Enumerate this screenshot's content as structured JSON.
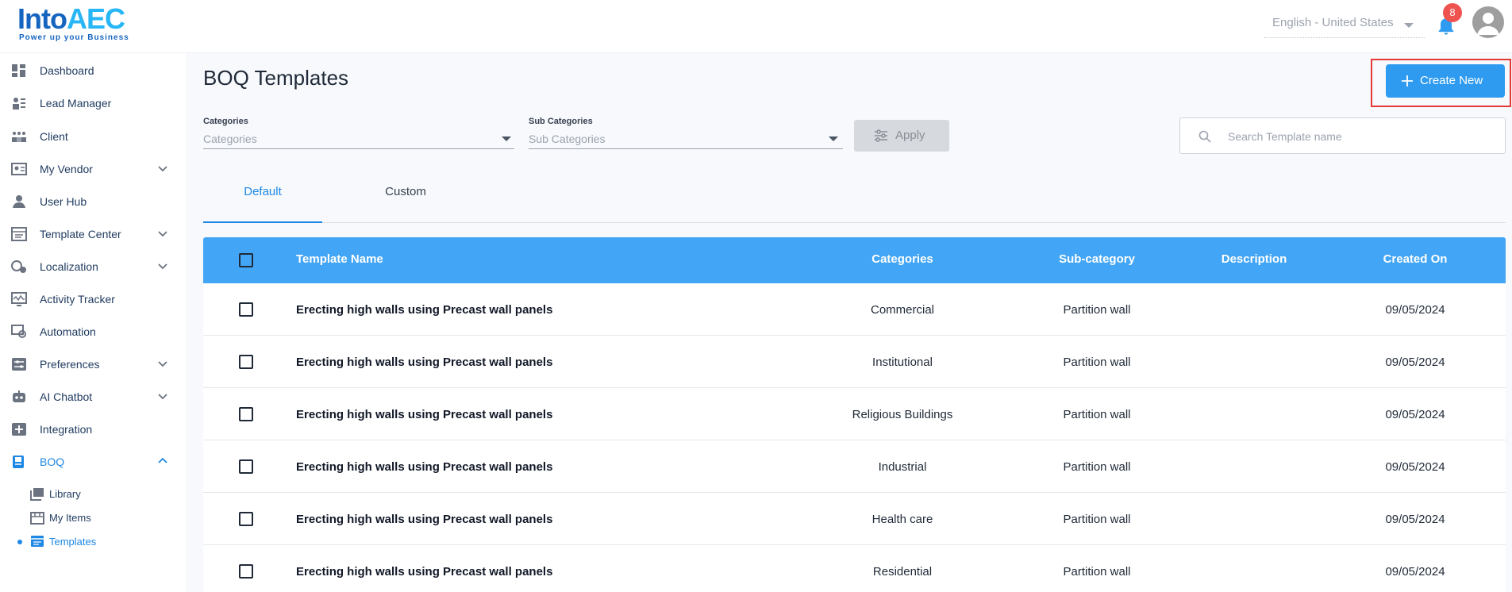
{
  "header": {
    "logo_main": "Into",
    "logo_accent": "AEC",
    "logo_tagline": "Power up your Business",
    "language": "English - United States",
    "notification_count": "8"
  },
  "sidebar": {
    "items": [
      {
        "label": "Dashboard",
        "icon": "dashboard-icon"
      },
      {
        "label": "Lead Manager",
        "icon": "lead-manager-icon"
      },
      {
        "label": "Client",
        "icon": "client-icon"
      },
      {
        "label": "My Vendor",
        "icon": "vendor-icon"
      },
      {
        "label": "User Hub",
        "icon": "user-icon"
      },
      {
        "label": "Template Center",
        "icon": "template-center-icon"
      },
      {
        "label": "Localization",
        "icon": "localization-icon"
      },
      {
        "label": "Activity Tracker",
        "icon": "activity-icon"
      },
      {
        "label": "Automation",
        "icon": "automation-icon"
      },
      {
        "label": "Preferences",
        "icon": "preferences-icon"
      },
      {
        "label": "AI Chatbot",
        "icon": "chatbot-icon"
      },
      {
        "label": "Integration",
        "icon": "integration-icon"
      },
      {
        "label": "BOQ",
        "icon": "boq-icon"
      }
    ],
    "boq_sub": [
      {
        "label": "Library",
        "icon": "library-icon"
      },
      {
        "label": "My Items",
        "icon": "my-items-icon"
      },
      {
        "label": "Templates",
        "icon": "templates-icon"
      }
    ]
  },
  "main": {
    "title": "BOQ Templates",
    "create_label": "Create New",
    "filters": {
      "categories_label": "Categories",
      "categories_value": "Categories",
      "subcategories_label": "Sub Categories",
      "subcategories_value": "Sub Categories",
      "apply_label": "Apply"
    },
    "search_placeholder": "Search Template name",
    "tabs": [
      {
        "label": "Default",
        "active": true
      },
      {
        "label": "Custom",
        "active": false
      }
    ],
    "table": {
      "headers": [
        "Template Name",
        "Categories",
        "Sub-category",
        "Description",
        "Created On"
      ],
      "rows": [
        {
          "name": "Erecting high walls using Precast wall panels",
          "category": "Commercial",
          "subcategory": "Partition wall",
          "description": "",
          "created": "09/05/2024"
        },
        {
          "name": "Erecting high walls using Precast wall panels",
          "category": "Institutional",
          "subcategory": "Partition wall",
          "description": "",
          "created": "09/05/2024"
        },
        {
          "name": "Erecting high walls using Precast wall panels",
          "category": "Religious Buildings",
          "subcategory": "Partition wall",
          "description": "",
          "created": "09/05/2024"
        },
        {
          "name": "Erecting high walls using Precast wall panels",
          "category": "Industrial",
          "subcategory": "Partition wall",
          "description": "",
          "created": "09/05/2024"
        },
        {
          "name": "Erecting high walls using Precast wall panels",
          "category": "Health care",
          "subcategory": "Partition wall",
          "description": "",
          "created": "09/05/2024"
        },
        {
          "name": "Erecting high walls using Precast wall panels",
          "category": "Residential",
          "subcategory": "Partition wall",
          "description": "",
          "created": "09/05/2024"
        }
      ]
    }
  },
  "colors": {
    "accent": "#2e9bf0",
    "table_header": "#42a5f5",
    "highlight": "#e53935",
    "badge": "#ef5350"
  }
}
